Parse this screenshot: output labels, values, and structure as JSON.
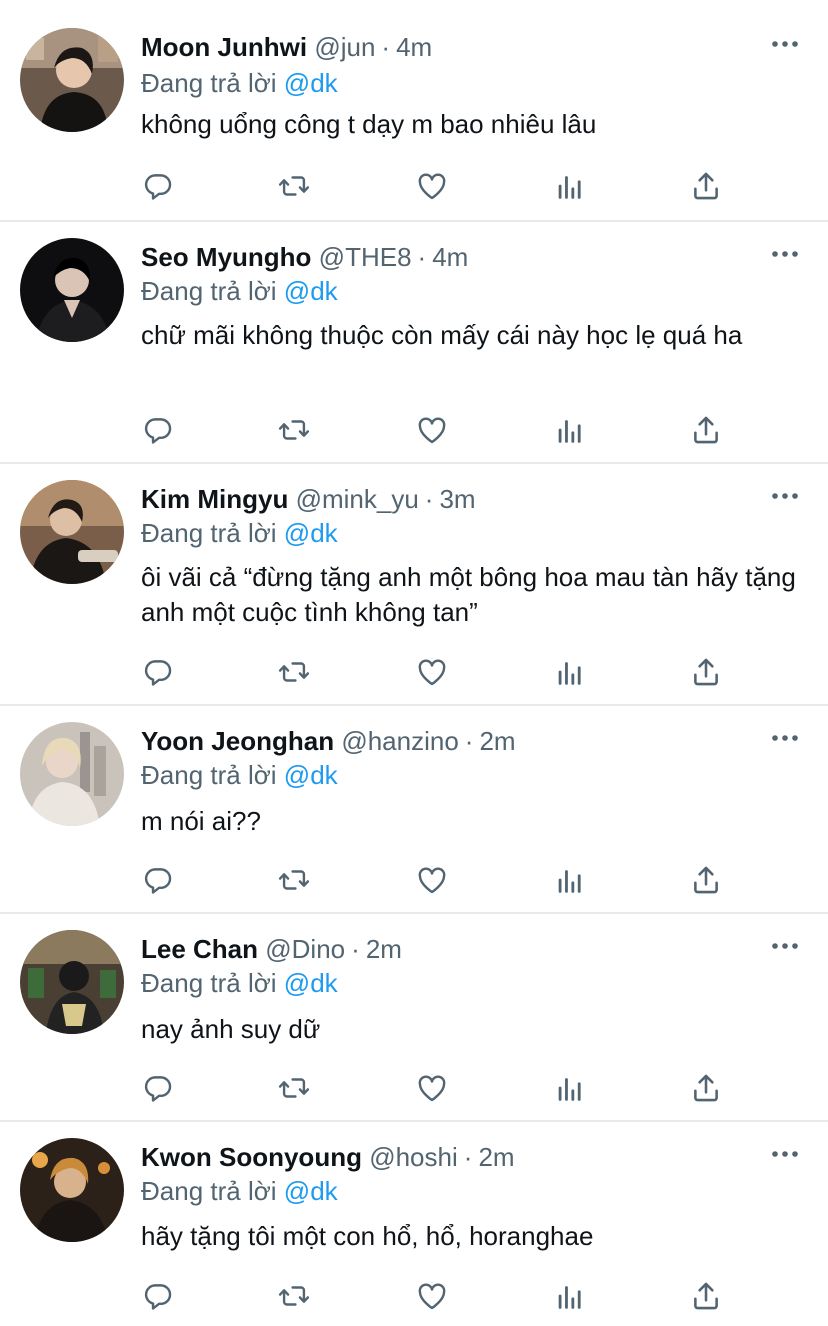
{
  "reply_prefix": "Đang trả lời",
  "tweets": [
    {
      "name": "Moon Junhwi",
      "handle": "@jun",
      "sep": "·",
      "time": "4m",
      "reply_to": "@dk",
      "text": "không uổng công t dạy m bao nhiêu lâu"
    },
    {
      "name": "Seo Myungho",
      "handle": "@THE8",
      "sep": "·",
      "time": "4m",
      "reply_to": "@dk",
      "text": "chữ mãi không thuộc còn mấy cái này học lẹ quá ha"
    },
    {
      "name": "Kim Mingyu",
      "handle": "@mink_yu",
      "sep": "·",
      "time": "3m",
      "reply_to": "@dk",
      "text": "ôi vãi cả “đừng tặng anh một bông hoa mau tàn hãy tặng anh một cuộc tình không tan”"
    },
    {
      "name": "Yoon Jeonghan",
      "handle": "@hanzino",
      "sep": "·",
      "time": "2m",
      "reply_to": "@dk",
      "text": "m nói ai??"
    },
    {
      "name": "Lee Chan",
      "handle": "@Dino",
      "sep": "·",
      "time": "2m",
      "reply_to": "@dk",
      "text": "nay ảnh suy dữ"
    },
    {
      "name": "Kwon Soonyoung",
      "handle": "@hoshi",
      "sep": "·",
      "time": "2m",
      "reply_to": "@dk",
      "text": "hãy tặng tôi một con hổ, hổ, horanghae"
    }
  ],
  "colors": {
    "text": "#0f1419",
    "secondary": "#536471",
    "link": "#1d9bf0",
    "divider": "#e7e9ec"
  },
  "icons": {
    "more": "more-horizontal-icon",
    "reply": "reply-icon",
    "retweet": "retweet-icon",
    "like": "heart-icon",
    "views": "views-icon",
    "share": "share-icon"
  }
}
